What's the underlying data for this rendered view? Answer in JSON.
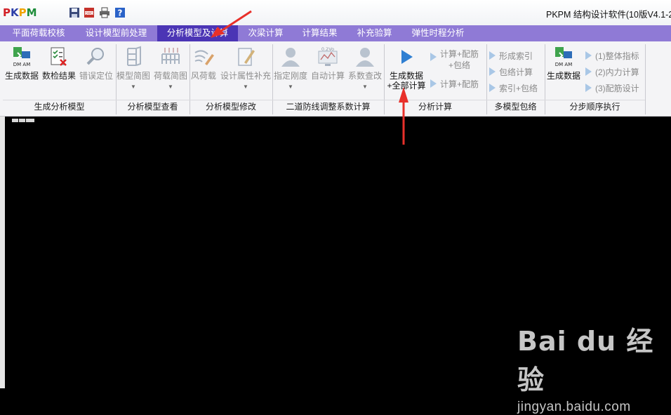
{
  "window": {
    "logo": "PKPM",
    "title": "PKPM 结构设计软件(10版V4.1-2"
  },
  "tabs": [
    {
      "label": "平面荷载校核"
    },
    {
      "label": "设计模型前处理"
    },
    {
      "label": "分析模型及计算"
    },
    {
      "label": "次梁计算"
    },
    {
      "label": "计算结果"
    },
    {
      "label": "补充验算"
    },
    {
      "label": "弹性时程分析"
    }
  ],
  "ribbon": {
    "groups": {
      "g1": {
        "label": "生成分析模型",
        "b1": "生成数据",
        "b2": "数检结果",
        "b3": "错误定位"
      },
      "g2": {
        "label": "分析模型查看",
        "b1": "模型简图",
        "b2": "荷载简图"
      },
      "g3": {
        "label": "分析模型修改",
        "b1": "风荷载",
        "b2": "设计属性补充"
      },
      "g4": {
        "label": "二道防线调整系数计算",
        "b1": "指定刚度",
        "b2": "自动计算",
        "b3": "系数查改",
        "icon_text": "0.2Vo"
      },
      "g5": {
        "label": "分析计算",
        "b1_line1": "生成数据",
        "b1_line2": "+全部计算",
        "s1_line1": "计算+配筋",
        "s1_line2": "+包络",
        "s2": "计算+配筋"
      },
      "g6": {
        "label": "多模型包络",
        "s1": "形成索引",
        "s2": "包络计算",
        "s3": "索引+包络"
      },
      "g7": {
        "label": "分步顺序执行",
        "b1": "生成数据",
        "s1": "(1)整体指标",
        "s2": "(2)内力计算",
        "s3": "(3)配筋设计"
      }
    },
    "dm_am": "DM AM"
  },
  "watermark": {
    "brand": "Bai du 经验",
    "url": "jingyan.baidu.com"
  }
}
